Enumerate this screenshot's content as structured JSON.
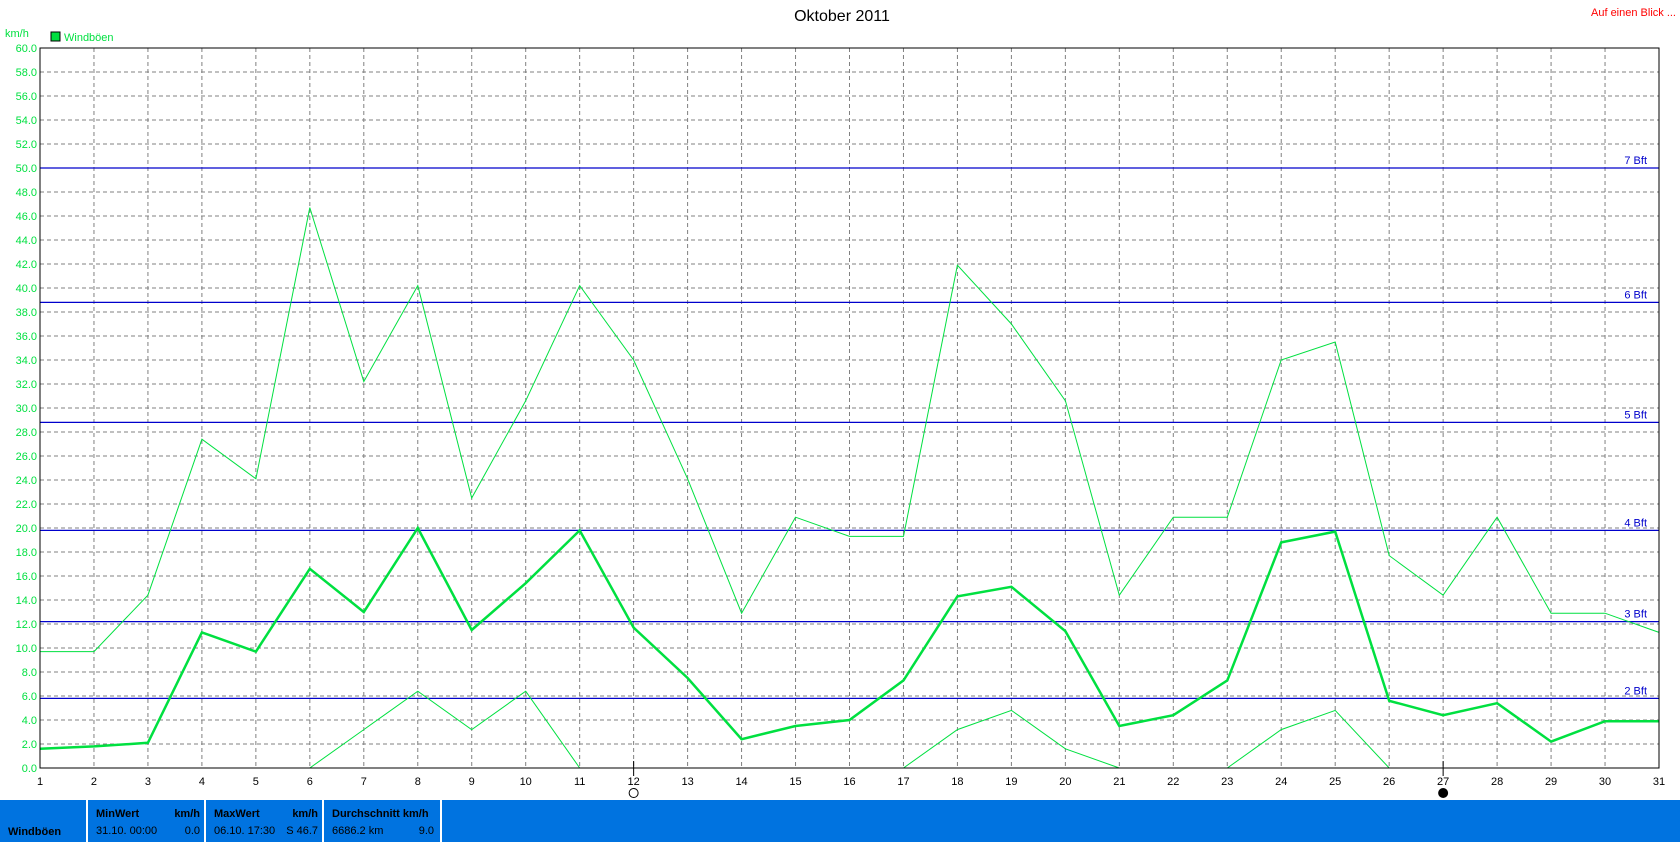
{
  "chart_data": {
    "type": "line",
    "title": "Oktober 2011",
    "ylabel": "km/h",
    "xlabel": "",
    "ylim": [
      0,
      60
    ],
    "yticks": [
      "0.0",
      "2.0",
      "4.0",
      "6.0",
      "8.0",
      "10.0",
      "12.0",
      "14.0",
      "16.0",
      "18.0",
      "20.0",
      "22.0",
      "24.0",
      "26.0",
      "28.0",
      "30.0",
      "32.0",
      "34.0",
      "36.0",
      "38.0",
      "40.0",
      "42.0",
      "44.0",
      "46.0",
      "48.0",
      "50.0",
      "52.0",
      "54.0",
      "56.0",
      "58.0",
      "60.0"
    ],
    "x": [
      1,
      2,
      3,
      4,
      5,
      6,
      7,
      8,
      9,
      10,
      11,
      12,
      13,
      14,
      15,
      16,
      17,
      18,
      19,
      20,
      21,
      22,
      23,
      24,
      25,
      26,
      27,
      28,
      29,
      30,
      31
    ],
    "grid": true,
    "legend": {
      "placement": "top-left",
      "label": "Windböen"
    },
    "series": [
      {
        "name": "Windböen",
        "color": "#00e040",
        "values": [
          1.6,
          1.8,
          2.1,
          11.3,
          9.7,
          16.6,
          13.0,
          20.0,
          11.5,
          15.4,
          19.8,
          11.7,
          7.5,
          2.4,
          3.5,
          4.0,
          7.3,
          14.3,
          15.1,
          11.4,
          3.5,
          4.4,
          7.3,
          18.8,
          19.7,
          5.6,
          4.4,
          5.4,
          2.2,
          3.9,
          3.9
        ]
      },
      {
        "role": "max",
        "color": "#00e040",
        "values": [
          9.7,
          9.7,
          14.4,
          27.4,
          24.1,
          46.7,
          32.2,
          40.2,
          22.5,
          30.6,
          40.2,
          34.0,
          24.1,
          12.9,
          20.9,
          19.3,
          19.3,
          41.9,
          37.0,
          30.6,
          14.4,
          20.9,
          20.9,
          34.0,
          35.5,
          17.7,
          14.4,
          20.9,
          12.9,
          12.9,
          11.3
        ]
      },
      {
        "role": "min",
        "color": "#00e040",
        "values": [
          null,
          null,
          null,
          null,
          null,
          0,
          3.2,
          6.4,
          3.2,
          6.4,
          0,
          null,
          null,
          null,
          null,
          null,
          0,
          3.2,
          4.8,
          1.6,
          0,
          null,
          0,
          3.2,
          4.8,
          0,
          null,
          null,
          null,
          null,
          null
        ]
      }
    ],
    "reference_lines": [
      {
        "label": "2 Bft",
        "value": 5.8
      },
      {
        "label": "3 Bft",
        "value": 12.2
      },
      {
        "label": "4 Bft",
        "value": 19.8
      },
      {
        "label": "5 Bft",
        "value": 28.8
      },
      {
        "label": "6 Bft",
        "value": 38.8
      },
      {
        "label": "7 Bft",
        "value": 50.0
      }
    ],
    "moon_markers": [
      {
        "day": 12,
        "phase": "full-moon"
      },
      {
        "day": 27,
        "phase": "new-moon"
      }
    ]
  },
  "header": {
    "link_label": "Auf einen Blick ..."
  },
  "stats": {
    "name": "Windböen",
    "min": {
      "head": "MinWert",
      "unit": "km/h",
      "date": "31.10.  00:00",
      "value": "0.0"
    },
    "max": {
      "head": "MaxWert",
      "unit": "km/h",
      "date": "06.10.  17:30",
      "value": "S 46.7"
    },
    "avg": {
      "head": "Durchschnitt km/h",
      "distance": "6686.2 km",
      "value": "9.0"
    }
  },
  "colors": {
    "series": "#00e040",
    "reference": "#0000cc",
    "stats_bar": "#0073e0",
    "link": "#ff0000"
  }
}
